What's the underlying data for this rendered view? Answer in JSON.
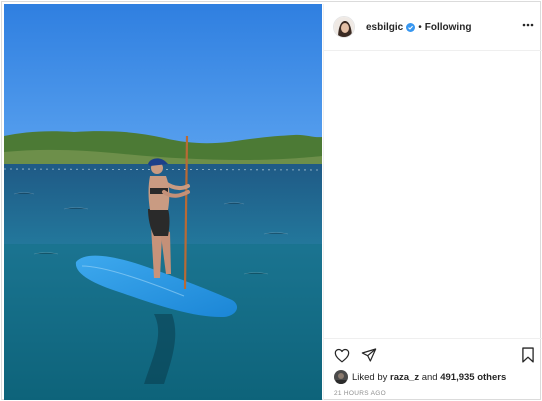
{
  "post": {
    "username": "esbilgic",
    "separator": "•",
    "follow_label": "Following",
    "likes": {
      "prefix": "Liked by",
      "liker": "raza_z",
      "conjunction": "and",
      "others": "491,935 others"
    },
    "timestamp": "21 HOURS AGO"
  },
  "icons": {
    "verified": "verified-badge-icon",
    "more": "more-options-icon",
    "like": "heart-icon",
    "share": "share-icon",
    "save": "bookmark-icon"
  },
  "colors": {
    "verified_blue": "#3897f0",
    "text": "#262626",
    "muted": "#8e8e8e",
    "border": "#dbdbdb"
  }
}
